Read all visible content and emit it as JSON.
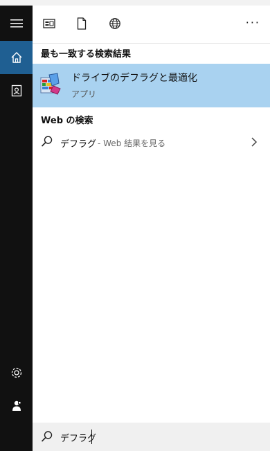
{
  "topbar": {
    "icons": [
      "apps-icon",
      "document-icon",
      "globe-icon"
    ],
    "more_label": "···"
  },
  "sidebar": {
    "items": [
      "menu-icon",
      "home-icon",
      "notebook-icon",
      "settings-icon",
      "user-icon"
    ],
    "active": "home-icon"
  },
  "results": {
    "best_match_heading": "最も一致する検索結果",
    "best_match": {
      "title": "ドライブのデフラグと最適化",
      "subtitle": "アプリ"
    },
    "web_heading": "Web の検索",
    "web_item": {
      "term": "デフラグ",
      "suffix": "- Web 結果を見る"
    }
  },
  "search": {
    "value": "デフラグ"
  },
  "colors": {
    "sidebar_bg": "#111111",
    "active_bg": "#1f5f92",
    "highlight_bg": "#a9d2f0",
    "searchbar_bg": "#f0f0f0"
  }
}
